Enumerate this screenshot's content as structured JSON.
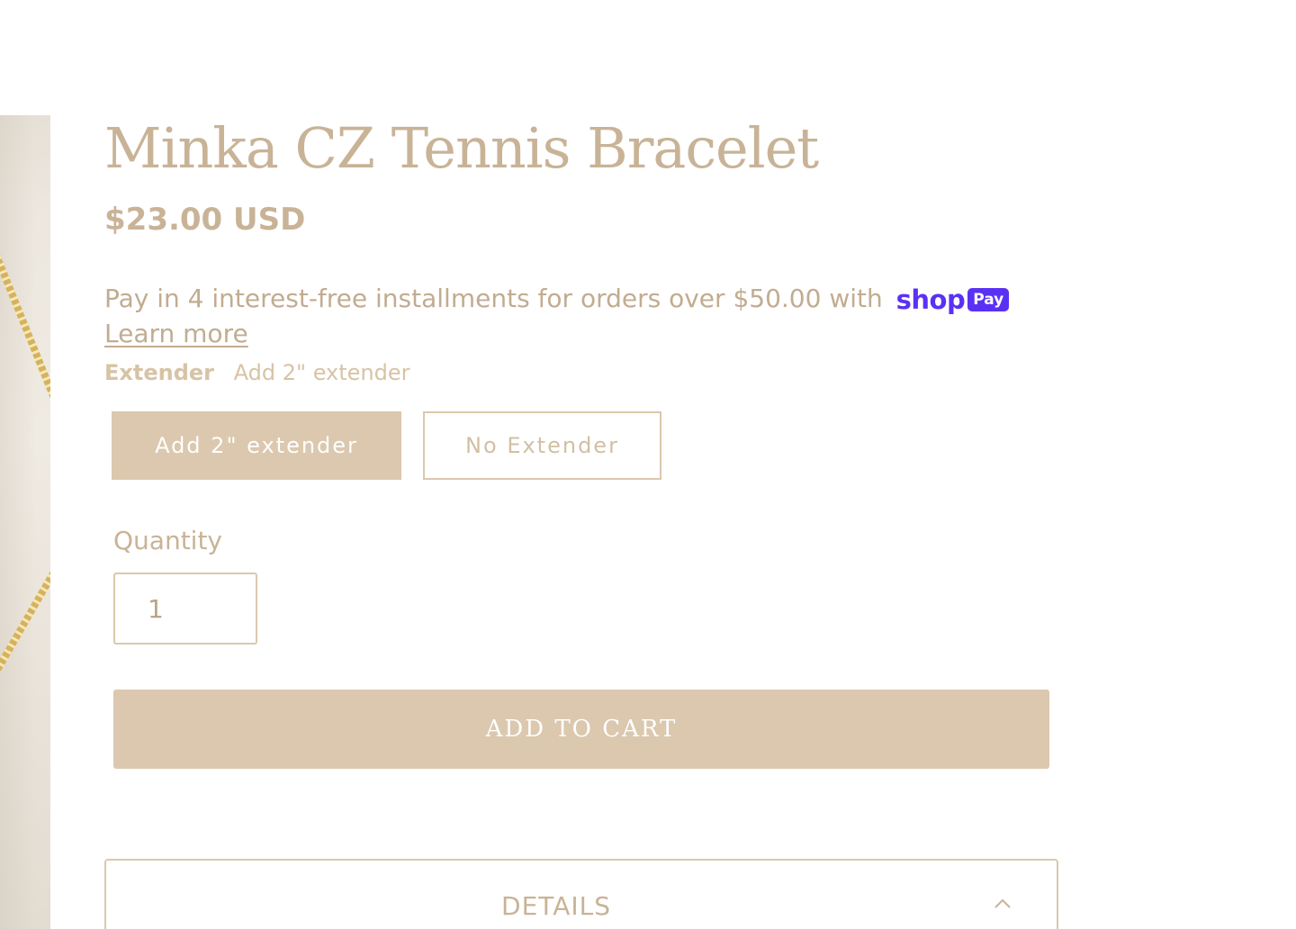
{
  "product": {
    "title": "Minka CZ Tennis Bracelet",
    "price": "$23.00 USD",
    "installments_text": "Pay in 4 interest-free installments for orders over $50.00 with",
    "shoppay": {
      "shop": "shop",
      "pay": "Pay"
    },
    "learn_more": "Learn more"
  },
  "option": {
    "name": "Extender",
    "selected_value": "Add 2\" extender",
    "choices": [
      {
        "label": "Add 2\" extender",
        "selected": true
      },
      {
        "label": "No Extender",
        "selected": false
      }
    ]
  },
  "quantity": {
    "label": "Quantity",
    "value": "1"
  },
  "cart": {
    "add_label": "ADD TO CART"
  },
  "details": {
    "label": "DETAILS",
    "icon": "chevron-up-icon"
  },
  "colors": {
    "accent": "#dbc8ae",
    "text": "#c9b397",
    "shoppay": "#5a31f4"
  }
}
